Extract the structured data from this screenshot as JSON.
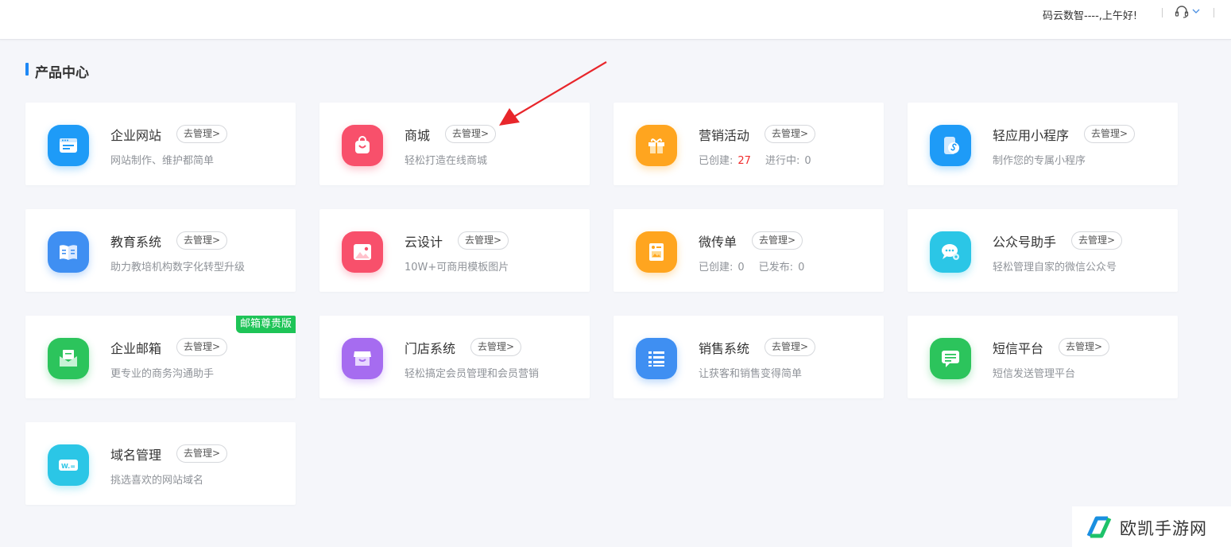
{
  "header": {
    "greeting": "码云数智----,上午好!",
    "support_icon": "headset-icon",
    "dropdown_icon": "chevron-down-icon"
  },
  "section": {
    "title": "产品中心"
  },
  "manage_label": "去管理>",
  "accent_color": "#1e88f5",
  "cards": [
    {
      "name": "企业网站",
      "desc": "网站制作、维护都简单",
      "icon": "website-icon",
      "color": "#1e9bf7"
    },
    {
      "name": "商城",
      "desc": "轻松打造在线商城",
      "icon": "shopping-bag-icon",
      "color": "#f8506b"
    },
    {
      "name": "营销活动",
      "icon": "gift-icon",
      "color": "#ffa51f",
      "stats": [
        {
          "label": "已创建:",
          "value": "27"
        },
        {
          "label": "进行中:",
          "value": "0"
        }
      ]
    },
    {
      "name": "轻应用小程序",
      "desc": "制作您的专属小程序",
      "icon": "mini-program-icon",
      "color": "#1e9bf7"
    },
    {
      "name": "教育系统",
      "desc": "助力教培机构数字化转型升级",
      "icon": "book-icon",
      "color": "#3f8ff2"
    },
    {
      "name": "云设计",
      "desc": "10W+可商用模板图片",
      "icon": "image-icon",
      "color": "#f8506b"
    },
    {
      "name": "微传单",
      "icon": "flyer-icon",
      "color": "#ffa51f",
      "stats": [
        {
          "label": "已创建:",
          "value": "0"
        },
        {
          "label": "已发布:",
          "value": "0"
        }
      ]
    },
    {
      "name": "公众号助手",
      "desc": "轻松管理自家的微信公众号",
      "icon": "wechat-icon",
      "color": "#2bc6e6"
    },
    {
      "name": "企业邮箱",
      "desc": "更专业的商务沟通助手",
      "icon": "mail-icon",
      "color": "#2cc45c",
      "badge": "邮箱尊贵版",
      "badge_color": "#1ec457"
    },
    {
      "name": "门店系统",
      "desc": "轻松搞定会员管理和会员营销",
      "icon": "store-icon",
      "color": "#a66cf0"
    },
    {
      "name": "销售系统",
      "desc": "让获客和销售变得简单",
      "icon": "list-icon",
      "color": "#3f8ff2"
    },
    {
      "name": "短信平台",
      "desc": "短信发送管理平台",
      "icon": "sms-icon",
      "color": "#2cc45c"
    },
    {
      "name": "域名管理",
      "desc": "挑选喜欢的网站域名",
      "icon": "domain-icon",
      "color": "#2bc6e6"
    }
  ],
  "annotation": {
    "arrow_color": "#e8262b"
  },
  "watermark": {
    "text": "欧凯手游网",
    "icon": "watermark-logo-icon"
  }
}
